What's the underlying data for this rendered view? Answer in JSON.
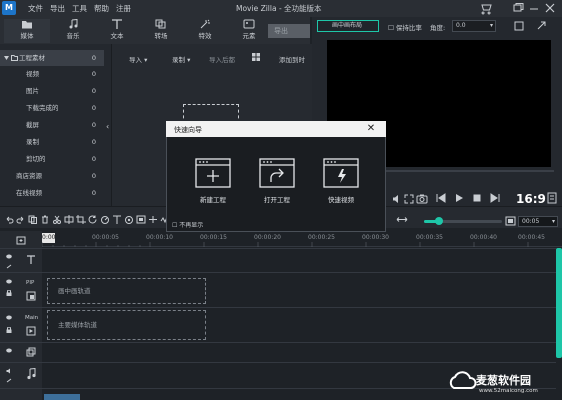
{
  "app": {
    "logo_text": "M",
    "title": "Movie Zilla  -  全功能版本"
  },
  "menu": [
    "文件",
    "导出",
    "工具",
    "帮助",
    "注册"
  ],
  "toolbar": {
    "tools": [
      {
        "label": "媒体",
        "icon": "folder-icon"
      },
      {
        "label": "音乐",
        "icon": "music-note-icon"
      },
      {
        "label": "文本",
        "icon": "text-icon"
      },
      {
        "label": "转场",
        "icon": "transition-icon"
      },
      {
        "label": "特效",
        "icon": "effects-icon"
      },
      {
        "label": "元素",
        "icon": "elements-icon"
      }
    ],
    "export_label": "导出"
  },
  "sidebar": {
    "root": {
      "label": "工程素材",
      "count": "0"
    },
    "items": [
      {
        "label": "视频",
        "count": "0"
      },
      {
        "label": "图片",
        "count": "0"
      },
      {
        "label": "下载完成的",
        "count": "0"
      },
      {
        "label": "截屏",
        "count": "0"
      },
      {
        "label": "录制",
        "count": "0"
      },
      {
        "label": "剪切的",
        "count": "0"
      },
      {
        "label": "商店资源",
        "count": "0"
      },
      {
        "label": "在线视频",
        "count": "0"
      }
    ]
  },
  "media_bar": {
    "import": "导入",
    "record": "录制",
    "import_later": "导入后都",
    "add_to": "添加到时"
  },
  "preview": {
    "layout_button": "画中画布局",
    "keep_ratio": "保持比率",
    "angle_label": "角度:",
    "angle_value": "0.0",
    "ratio": "16:9"
  },
  "dialog": {
    "title": "快速向导",
    "options": [
      {
        "label": "新建工程",
        "icon": "new-project-icon"
      },
      {
        "label": "打开工程",
        "icon": "open-project-icon"
      },
      {
        "label": "快速视频",
        "icon": "quick-video-icon"
      }
    ],
    "dont_show": "不再显示"
  },
  "timeline": {
    "time_value": "00:05",
    "playhead_label": "0:00",
    "ticks": [
      "00:00:05",
      "00:00:10",
      "00:00:15",
      "00:00:20",
      "00:00:25",
      "00:00:30",
      "00:00:35",
      "00:00:40",
      "00:00:45"
    ],
    "pip_label": "PIP",
    "main_label": "Main",
    "pip_zone": "画中画轨道",
    "main_zone": "主要媒体轨道"
  },
  "watermark": {
    "name": "麦葱软件园",
    "url": "www.52maicong.com"
  },
  "colors": {
    "accent": "#1ec6a8",
    "background": "#1e2227"
  }
}
